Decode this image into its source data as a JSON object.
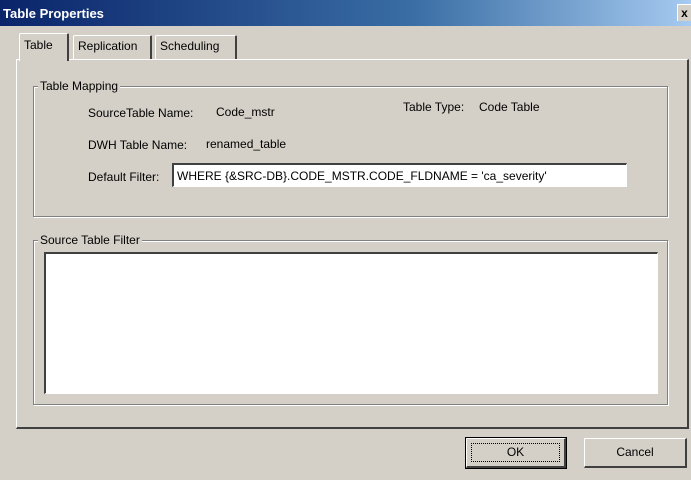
{
  "window": {
    "title": "Table Properties",
    "close_glyph": "x"
  },
  "tabs": [
    {
      "label": "Table",
      "active": true
    },
    {
      "label": "Replication",
      "active": false
    },
    {
      "label": "Scheduling",
      "active": false
    }
  ],
  "table_mapping": {
    "group_label": "Table Mapping",
    "source_table_label": "SourceTable Name:",
    "source_table_value": "Code_mstr",
    "table_type_label": "Table Type:",
    "table_type_value": "Code Table",
    "dwh_table_label": "DWH Table Name:",
    "dwh_table_value": "renamed_table",
    "default_filter_label": "Default Filter:",
    "default_filter_value": "WHERE {&SRC-DB}.CODE_MSTR.CODE_FLDNAME = 'ca_severity'"
  },
  "source_table_filter": {
    "group_label": "Source Table Filter",
    "value": ""
  },
  "buttons": {
    "ok_label": "OK",
    "cancel_label": "Cancel"
  }
}
